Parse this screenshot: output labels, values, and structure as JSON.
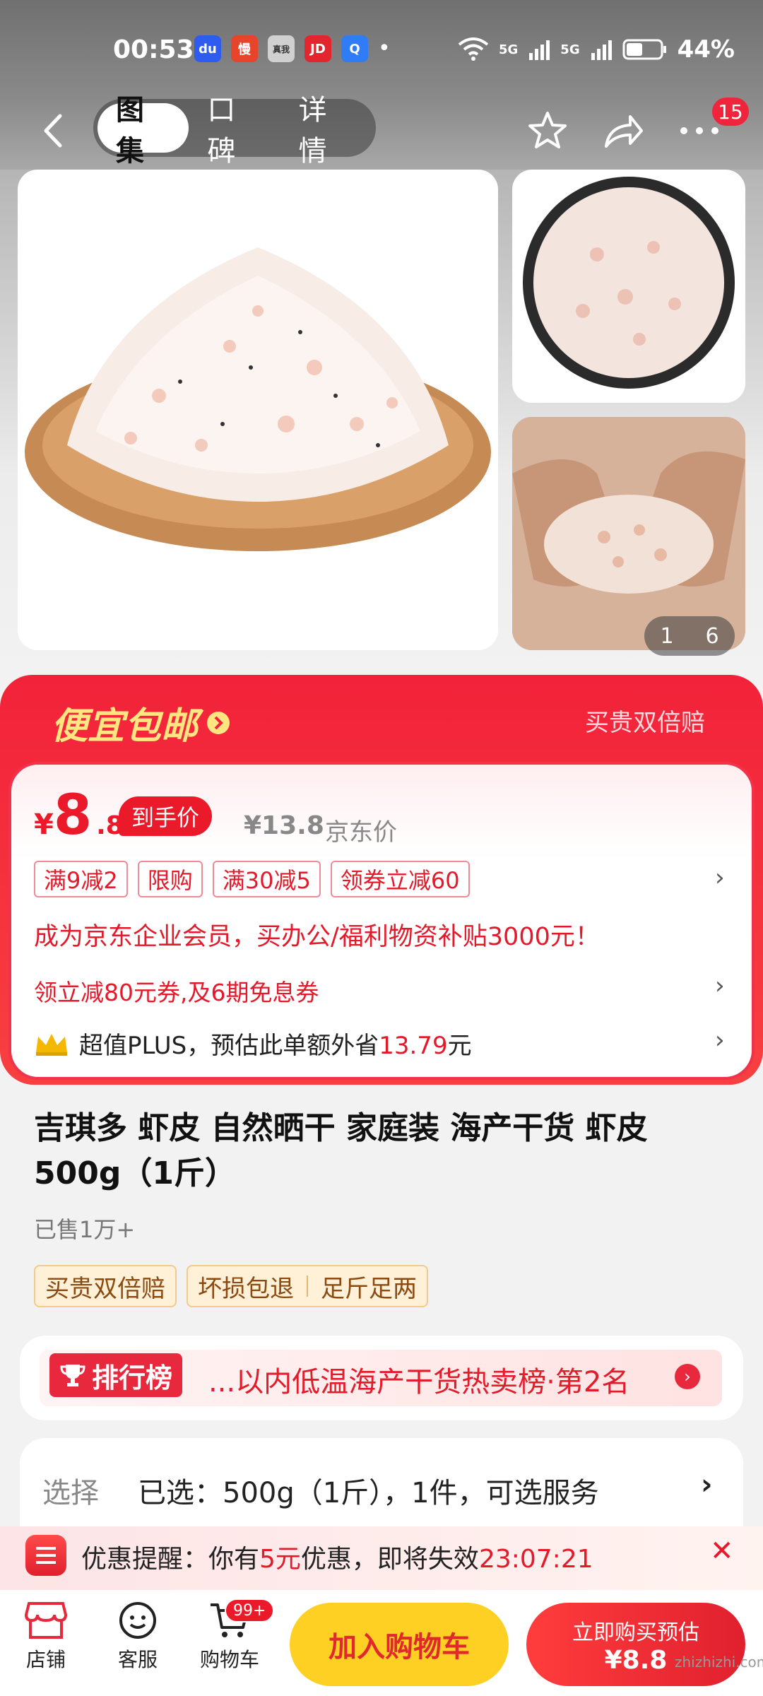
{
  "status_bar": {
    "time": "00:53",
    "apps": [
      {
        "name": "baidu-app-icon",
        "glyph": "du",
        "color": "#2e5bf0"
      },
      {
        "name": "manmanbuy-app-icon",
        "glyph": "慢",
        "color": "#e8432b"
      },
      {
        "name": "realme-app-icon",
        "glyph": "真我",
        "color": "#cccccc"
      },
      {
        "name": "jd-app-icon",
        "glyph": "JD",
        "color": "#e3262d"
      },
      {
        "name": "search-app-icon",
        "glyph": "Q",
        "color": "#2f7cf6"
      }
    ],
    "battery": "44%",
    "signal_1": "5G",
    "signal_2": "5G"
  },
  "nav": {
    "tabs": [
      {
        "label": "图集",
        "active": true
      },
      {
        "label": "口碑",
        "active": false
      },
      {
        "label": "详情",
        "active": false
      }
    ],
    "message_count": "15"
  },
  "gallery": {
    "current": "1",
    "total": "6"
  },
  "promo": {
    "title": "便宜包邮",
    "right_text": "买贵双倍赔",
    "price": {
      "yen": "¥",
      "integer": "8",
      "decimal": ".8",
      "tag": "到手价"
    },
    "original_price": "¥13.8",
    "original_label": "京东价",
    "coupons": [
      "满9减2",
      "限购",
      "满30减5",
      "领券立减60"
    ],
    "member_text": "成为京东企业会员，买办公/福利物资补贴3000元！",
    "voucher_text": "领立减80元券,及6期免息券",
    "plus_prefix": "超值PLUS，预估此单额外省",
    "plus_amount": "13.79",
    "plus_suffix": "元"
  },
  "product": {
    "title": "吉琪多 虾皮 自然晒干 家庭装 海产干货 虾皮500g（1斤）",
    "sold": "已售1万+",
    "service_tags": [
      "买贵双倍赔",
      "坏损包退",
      "足斤足两"
    ]
  },
  "rank": {
    "badge": "排行榜",
    "text": "...以内低温海产干货热卖榜·第2名"
  },
  "selection": {
    "label": "选择",
    "value": "已选：500g（1斤），1件，可选服务"
  },
  "discount_reminder": {
    "prefix": "优惠提醒：你有",
    "amount": "5元",
    "middle": "优惠，即将失效",
    "countdown": "23:07:21"
  },
  "bottom": {
    "shop": "店铺",
    "service": "客服",
    "cart": "购物车",
    "cart_badge": "99+",
    "add_to_cart": "加入购物车",
    "buy_line1": "立即购买预估",
    "buy_line2": "¥8.8"
  },
  "watermark": "zhizhizhi.com"
}
